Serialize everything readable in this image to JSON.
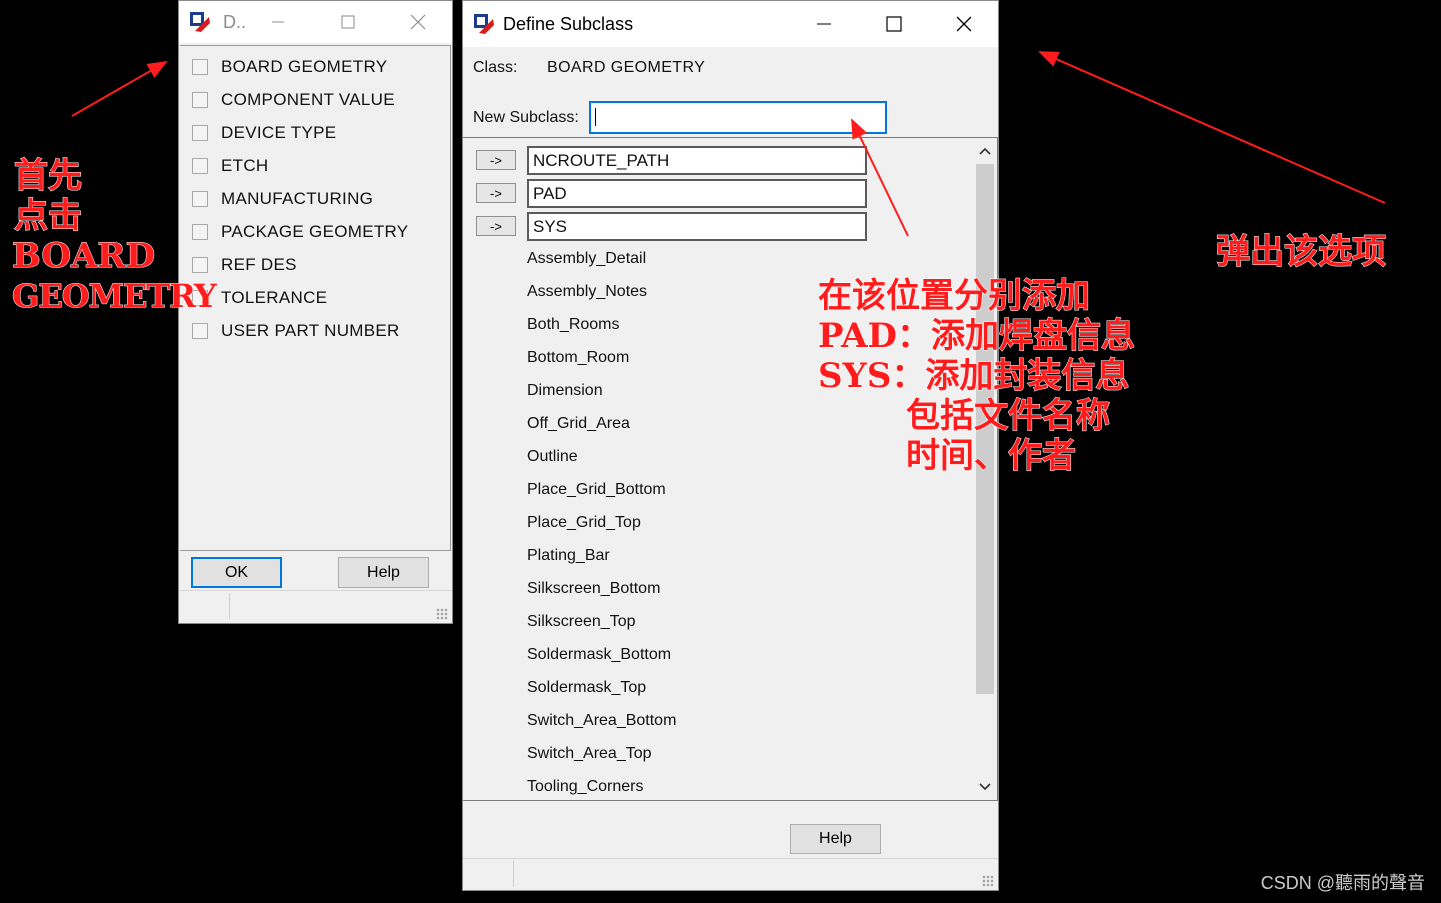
{
  "left_window": {
    "title": "D..",
    "items": [
      "BOARD GEOMETRY",
      "COMPONENT VALUE",
      "DEVICE TYPE",
      "ETCH",
      "MANUFACTURING",
      "PACKAGE GEOMETRY",
      "REF DES",
      "TOLERANCE",
      "USER PART NUMBER"
    ],
    "ok_label": "OK",
    "help_label": "Help"
  },
  "right_window": {
    "title": "Define Subclass",
    "class_label": "Class:",
    "class_value": "BOARD GEOMETRY",
    "new_subclass_label": "New Subclass:",
    "new_subclass_value": "",
    "arrow_label": "->",
    "editable": [
      "NCROUTE_PATH",
      "PAD",
      "SYS"
    ],
    "subclasses": [
      "Assembly_Detail",
      "Assembly_Notes",
      "Both_Rooms",
      "Bottom_Room",
      "Dimension",
      "Off_Grid_Area",
      "Outline",
      "Place_Grid_Bottom",
      "Place_Grid_Top",
      "Plating_Bar",
      "Silkscreen_Bottom",
      "Silkscreen_Top",
      "Soldermask_Bottom",
      "Soldermask_Top",
      "Switch_Area_Bottom",
      "Switch_Area_Top",
      "Tooling_Corners"
    ],
    "help_label": "Help"
  },
  "annotations": {
    "left_lines": [
      "首先",
      "点击",
      "BOARD",
      "GEOMETRY"
    ],
    "right": "弹出该选项",
    "middle_lines": [
      "在该位置分别添加",
      "PAD：添加焊盘信息",
      "SYS：添加封装信息",
      "包括文件名称",
      "时间、作者"
    ]
  },
  "watermark": "CSDN @聽雨的聲音",
  "colors": {
    "annotation": "#ff1c1c",
    "focus_border": "#0078d7"
  }
}
